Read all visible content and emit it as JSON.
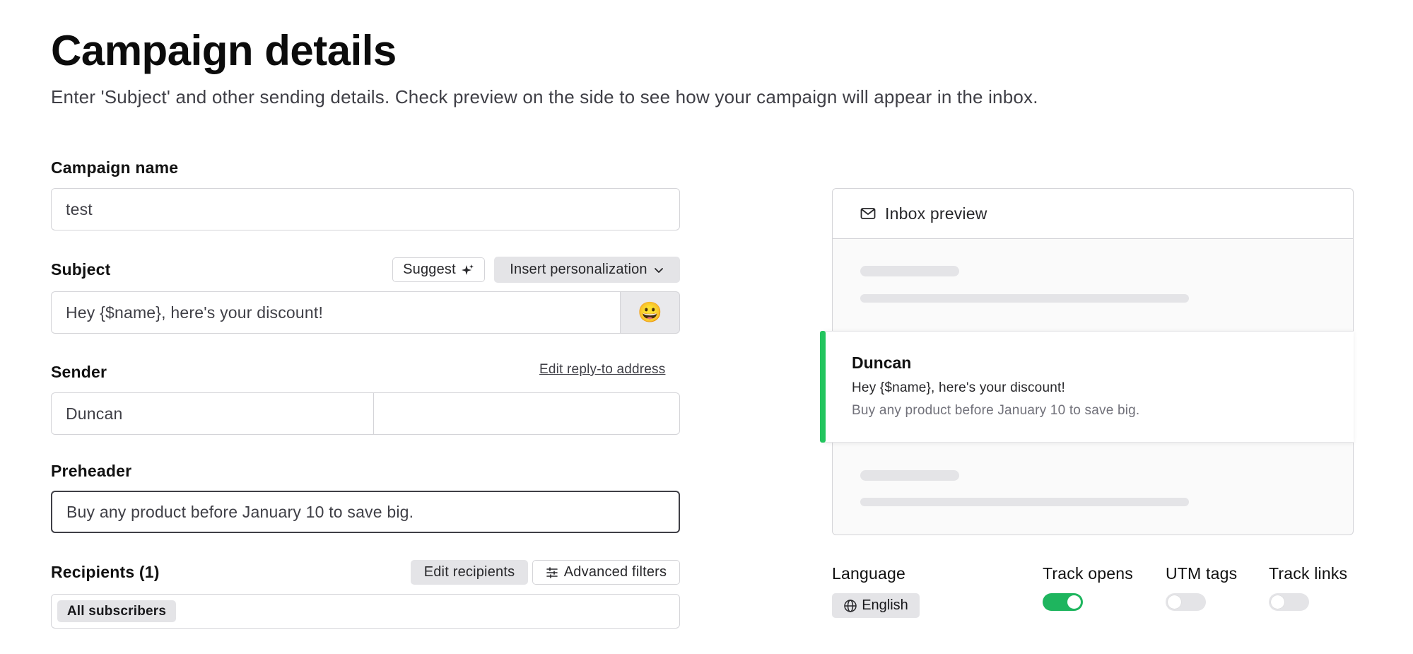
{
  "header": {
    "title": "Campaign details",
    "subtitle": "Enter 'Subject' and other sending details. Check preview on the side to see how your campaign will appear in the inbox."
  },
  "form": {
    "campaign_name": {
      "label": "Campaign name",
      "value": "test"
    },
    "subject": {
      "label": "Subject",
      "value": "Hey {$name}, here's your discount!",
      "suggest_label": "Suggest",
      "insert_personalization_label": "Insert personalization",
      "emoji": "😀"
    },
    "sender": {
      "label": "Sender",
      "edit_reply_to_label": "Edit reply-to address",
      "name_value": "Duncan",
      "email_value": ""
    },
    "preheader": {
      "label": "Preheader",
      "value": "Buy any product before January 10 to save big."
    },
    "recipients": {
      "label": "Recipients (1)",
      "edit_label": "Edit recipients",
      "advanced_filters_label": "Advanced filters",
      "tags": [
        "All subscribers"
      ]
    }
  },
  "preview": {
    "title": "Inbox preview",
    "sender": "Duncan",
    "subject": "Hey {$name}, here's your discount!",
    "preheader": "Buy any product before January 10 to save big.",
    "accent_color": "#22c55e"
  },
  "settings": {
    "language": {
      "label": "Language",
      "value": "English"
    },
    "track_opens": {
      "label": "Track opens",
      "enabled": true
    },
    "utm_tags": {
      "label": "UTM tags",
      "enabled": false
    },
    "track_links": {
      "label": "Track links",
      "enabled": false
    }
  },
  "colors": {
    "toggle_on": "#1eb55e",
    "toggle_off": "#e4e4e7"
  }
}
